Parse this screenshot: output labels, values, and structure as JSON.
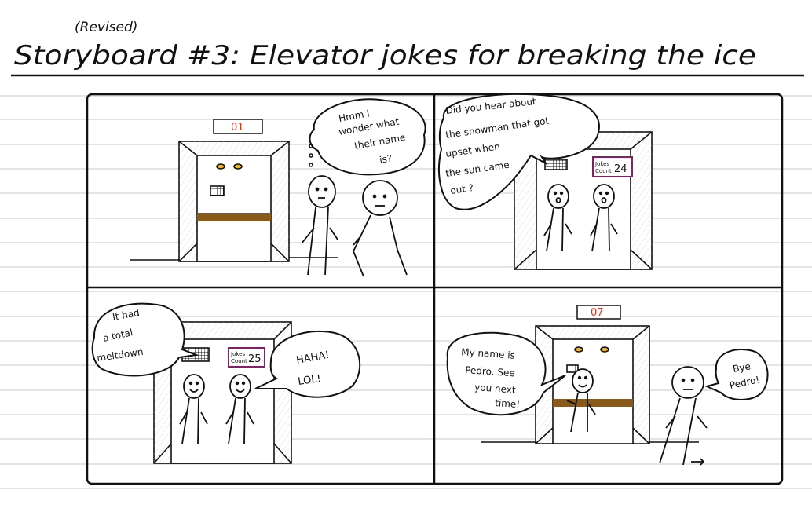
{
  "header": {
    "revised": "(Revised)",
    "title": "Storyboard #3: Elevator jokes for breaking the ice"
  },
  "panel1": {
    "floor": "01",
    "thought": [
      "Hmm I",
      "wonder what",
      "their name",
      "is?"
    ]
  },
  "panel2": {
    "speech": [
      "Did you hear about",
      "the snowman that got",
      "upset when",
      "the sun came",
      "out ?"
    ],
    "counter_label": [
      "Jokes",
      "Count"
    ],
    "counter_value": "24"
  },
  "panel3": {
    "speech_left": [
      "It had",
      "a total",
      "meltdown"
    ],
    "speech_right": [
      "HAHA!",
      "LOL!"
    ],
    "counter_label": [
      "Jokes",
      "Count"
    ],
    "counter_value": "25"
  },
  "panel4": {
    "floor": "07",
    "speech_left": [
      "My name is",
      "Pedro. See",
      "you next",
      "time!"
    ],
    "speech_right": [
      "Bye",
      "Pedro!"
    ]
  },
  "colors": {
    "ink": "#111111",
    "floor_display": "#e0341a",
    "counter_border": "#8a1a6a",
    "handrail": "#8a5a1a",
    "lights": "#f1b51c",
    "ruled_lines": "#c9c9c9"
  }
}
